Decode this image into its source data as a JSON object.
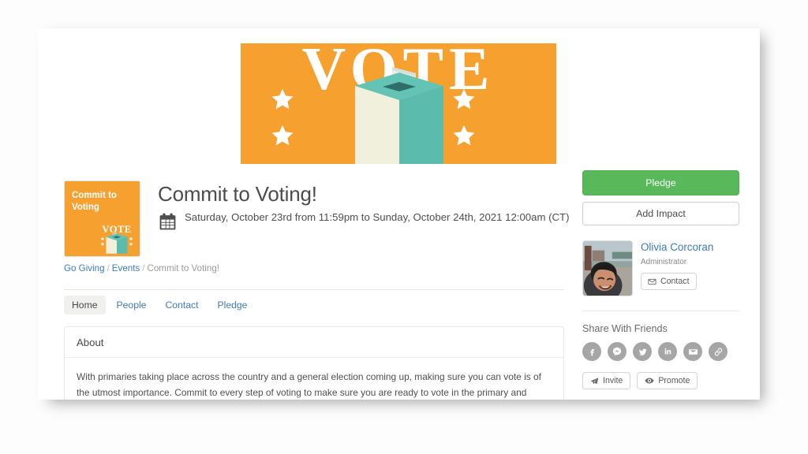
{
  "banner": {
    "alt": "vote-ballot-box-banner",
    "word": "VOTE",
    "bg_color": "#f6a030",
    "box_color": "#59bdb0",
    "box_front_color": "#f1f0dd",
    "star_count": 4
  },
  "event": {
    "thumbnail_title": "Commit to\nVoting",
    "thumbnail_alt": "commit-to-voting-thumbnail",
    "title": "Commit to Voting!",
    "date": "Saturday, October 23rd from 11:59pm to Sunday, October 24th, 2021 12:00am (CT)",
    "calendar_icon": "calendar-icon"
  },
  "breadcrumb": {
    "items": [
      {
        "label": "Go Giving",
        "link": true
      },
      {
        "label": "Events",
        "link": true
      },
      {
        "label": "Commit to Voting!",
        "link": false
      }
    ],
    "separator": "/"
  },
  "tabs": [
    {
      "label": "Home",
      "active": true
    },
    {
      "label": "People",
      "active": false
    },
    {
      "label": "Contact",
      "active": false
    },
    {
      "label": "Pledge",
      "active": false
    }
  ],
  "about": {
    "heading": "About",
    "body": "With primaries taking place across the country and a general election coming up, making sure you can vote is of the utmost importance. Commit to every step of voting to make sure you are ready to vote in the primary and national elections this year!"
  },
  "sidebar": {
    "pledge_button": "Pledge",
    "pledge_color": "#58b85a",
    "add_impact_button": "Add Impact",
    "organizer": {
      "name": "Olivia Corcoran",
      "role": "Administrator",
      "contact_button": "Contact",
      "contact_icon": "envelope-icon",
      "avatar_alt": "olivia-corcoran-avatar"
    },
    "share": {
      "heading": "Share With Friends",
      "icons": [
        {
          "name": "facebook-icon"
        },
        {
          "name": "messenger-icon"
        },
        {
          "name": "twitter-icon"
        },
        {
          "name": "linkedin-icon"
        },
        {
          "name": "email-icon"
        },
        {
          "name": "link-icon"
        }
      ],
      "invite_button": "Invite",
      "invite_icon": "paper-plane-icon",
      "promote_button": "Promote",
      "promote_icon": "eye-icon"
    }
  }
}
